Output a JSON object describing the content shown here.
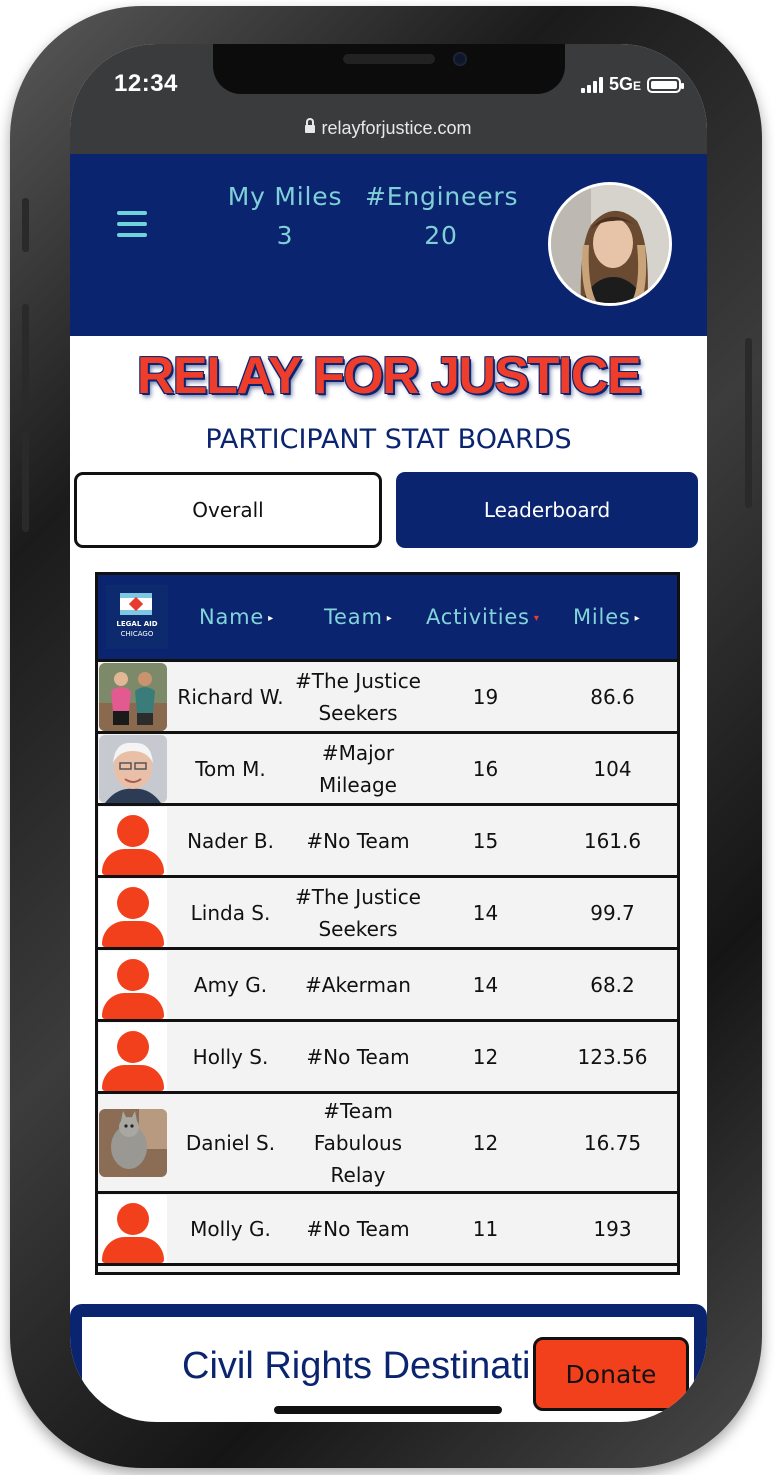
{
  "status": {
    "time": "12:34",
    "network": "5G",
    "network_suffix": "E"
  },
  "browser": {
    "url": "relayforjustice.com"
  },
  "header": {
    "stats": [
      {
        "label": "My Miles",
        "value": "3"
      },
      {
        "label": "#Engineers",
        "value": "20"
      }
    ]
  },
  "page": {
    "title": "RELAY FOR JUSTICE",
    "subtitle": "PARTICIPANT STAT BOARDS",
    "tabs": [
      {
        "label": "Overall",
        "active": false
      },
      {
        "label": "Leaderboard",
        "active": true
      }
    ]
  },
  "logo": {
    "line1": "LEGAL AID",
    "line2": "CHICAGO"
  },
  "table": {
    "columns": [
      {
        "label": "Name",
        "sort_arrow": "▸",
        "arrow_color": "#ffffff"
      },
      {
        "label": "Team",
        "sort_arrow": "▸",
        "arrow_color": "#ffffff"
      },
      {
        "label": "Activities",
        "sort_arrow": "▾",
        "arrow_color": "#ef3d2c"
      },
      {
        "label": "Miles",
        "sort_arrow": "▸",
        "arrow_color": "#ffffff"
      }
    ],
    "rows": [
      {
        "name": "Richard W.",
        "team": "#The Justice Seekers",
        "activities": "19",
        "miles": "86.6",
        "avatar": "photo-couple-icon"
      },
      {
        "name": "Tom M.",
        "team": "#Major Mileage",
        "activities": "16",
        "miles": "104",
        "avatar": "photo-man-icon"
      },
      {
        "name": "Nader B.",
        "team": "#No Team",
        "activities": "15",
        "miles": "161.6",
        "avatar": "person-placeholder-icon"
      },
      {
        "name": "Linda S.",
        "team": "#The Justice Seekers",
        "activities": "14",
        "miles": "99.7",
        "avatar": "person-placeholder-icon"
      },
      {
        "name": "Amy G.",
        "team": "#Akerman",
        "activities": "14",
        "miles": "68.2",
        "avatar": "person-placeholder-icon"
      },
      {
        "name": "Holly S.",
        "team": "#No Team",
        "activities": "12",
        "miles": "123.56",
        "avatar": "person-placeholder-icon"
      },
      {
        "name": "Daniel S.",
        "team": "#Team Fabulous Relay",
        "activities": "12",
        "miles": "16.75",
        "avatar": "photo-cat-icon"
      },
      {
        "name": "Molly G.",
        "team": "#No Team",
        "activities": "11",
        "miles": "193",
        "avatar": "person-placeholder-icon"
      }
    ]
  },
  "bottom": {
    "section_title": "Civil Rights Destinati",
    "donate_label": "Donate"
  },
  "colors": {
    "navy": "#0b2470",
    "accent_red": "#ef3d2c",
    "teal": "#7fd0d6",
    "placeholder": "#f2401d"
  }
}
